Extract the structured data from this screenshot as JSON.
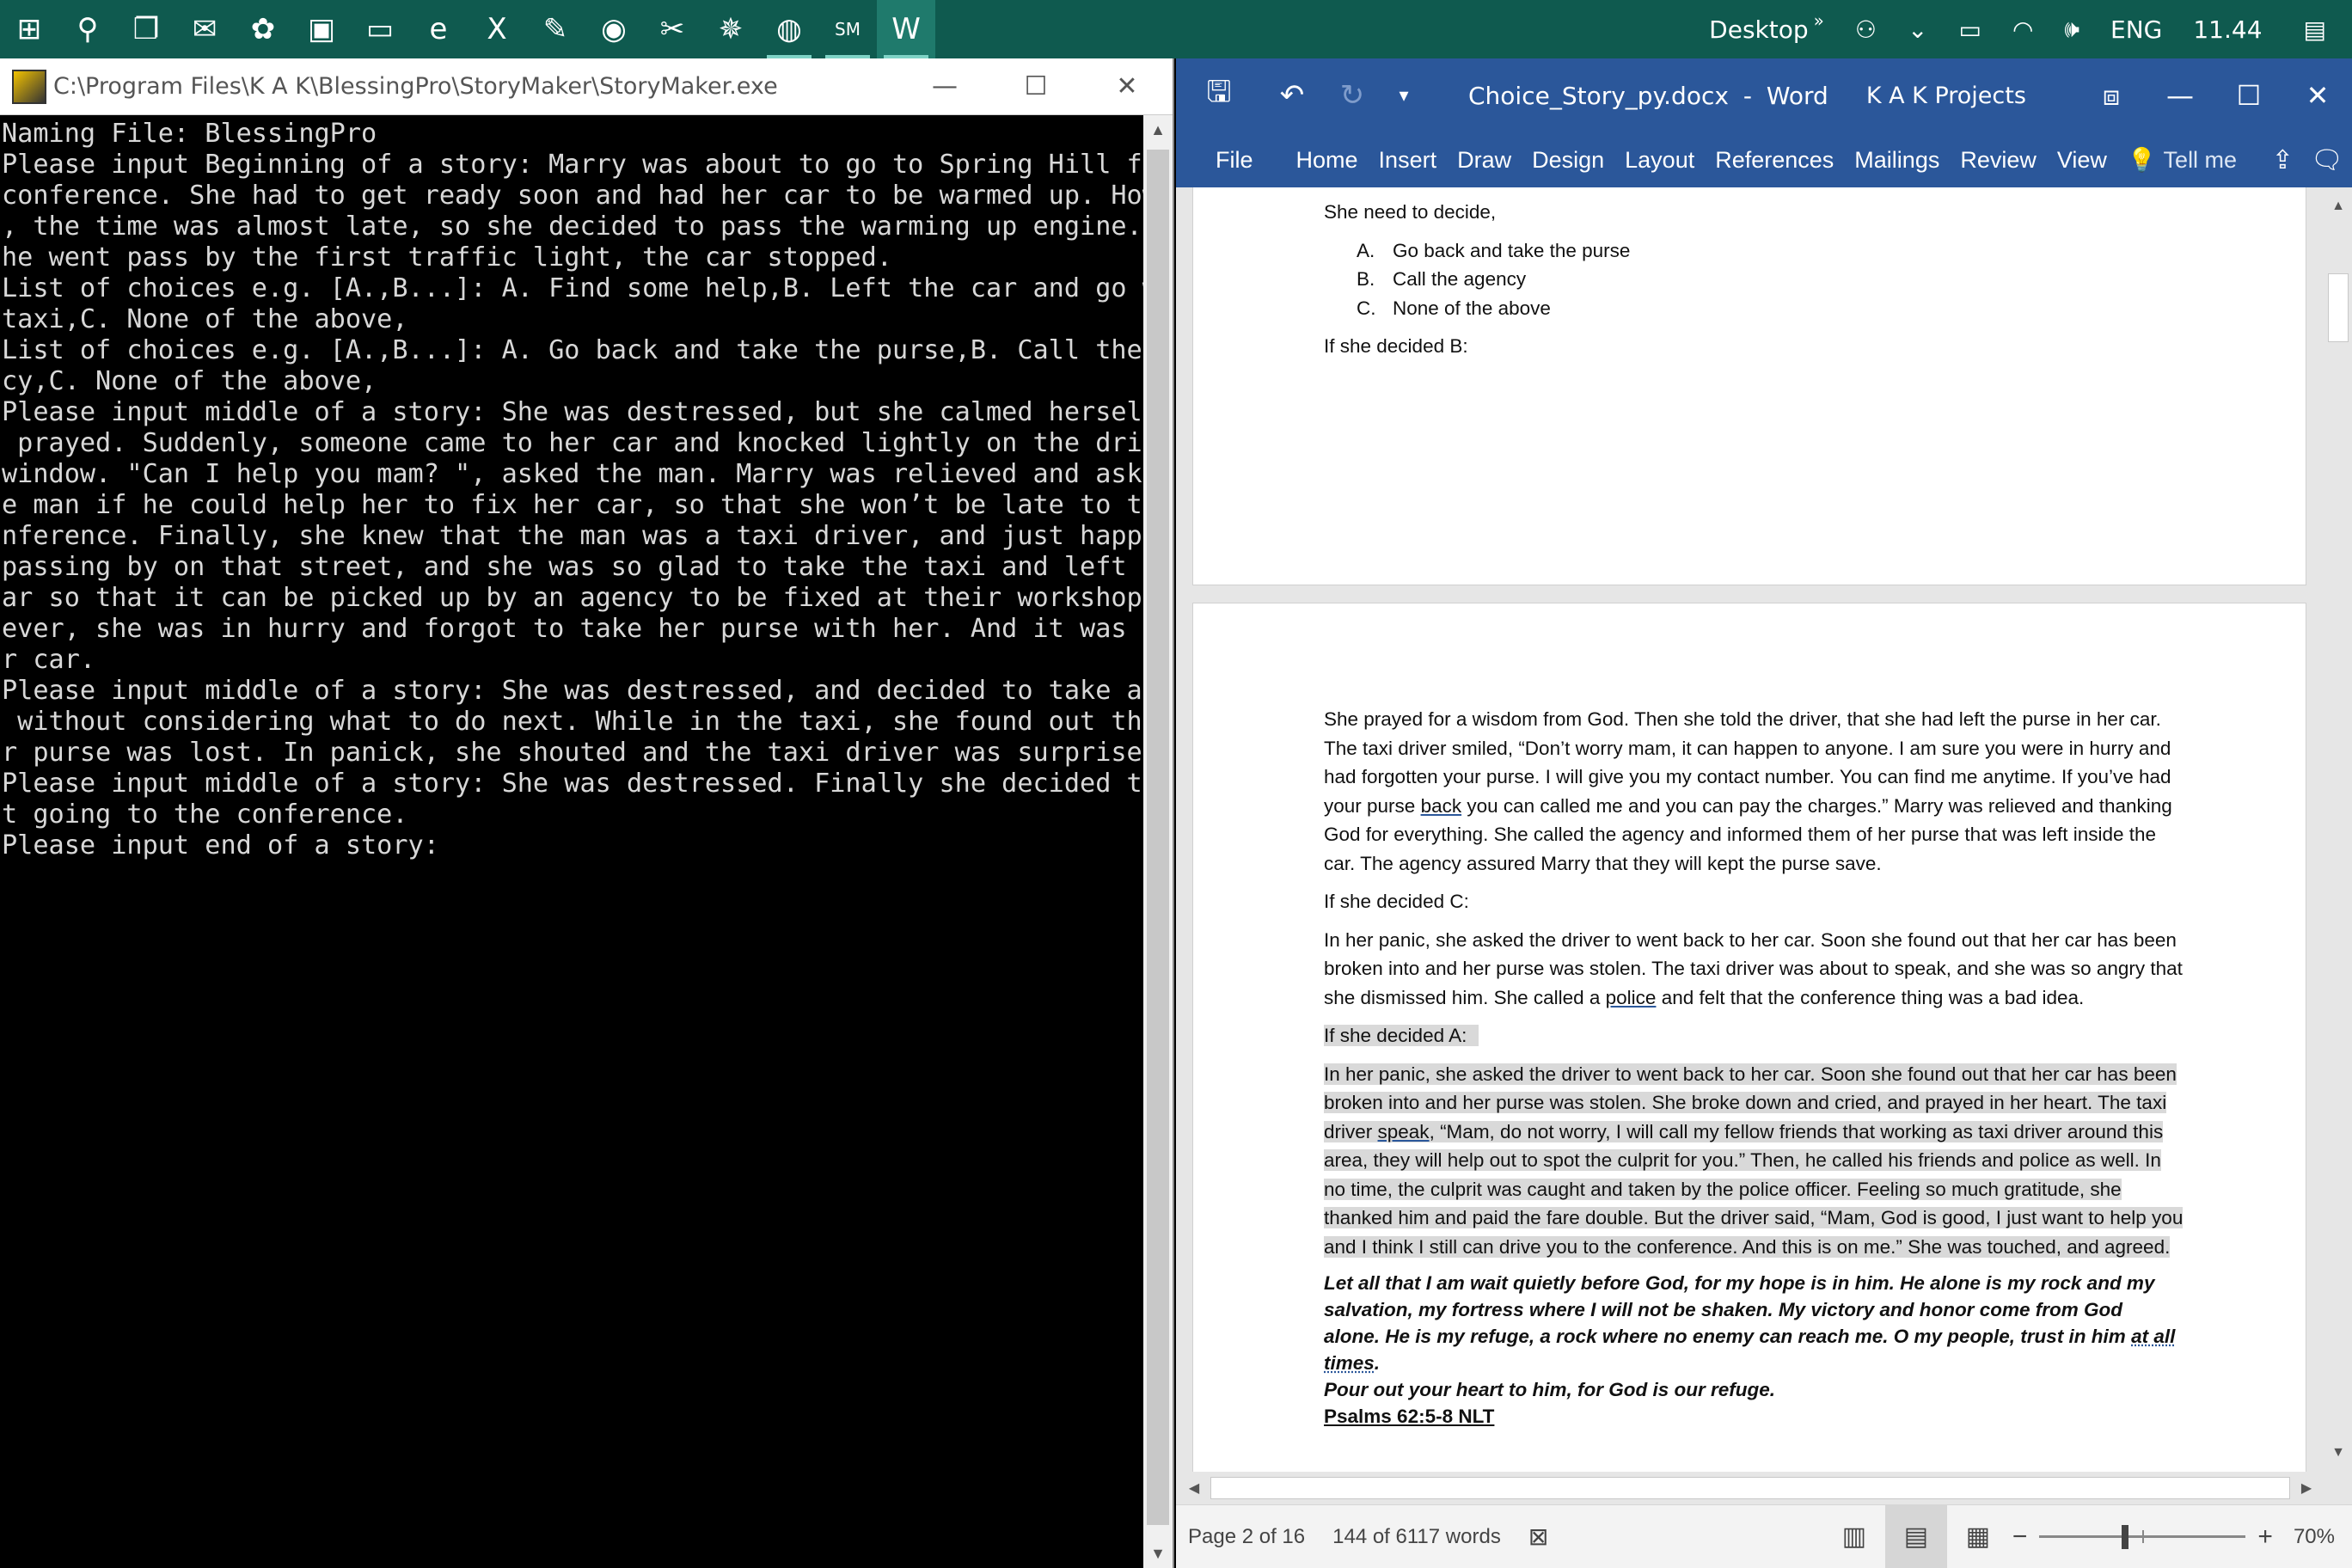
{
  "taskbar": {
    "icons": [
      {
        "name": "start-icon",
        "glyph": "⊞"
      },
      {
        "name": "search-icon",
        "glyph": "⚲"
      },
      {
        "name": "task-view-icon",
        "glyph": "❐"
      },
      {
        "name": "mail-icon",
        "glyph": "✉"
      },
      {
        "name": "paint-icon",
        "glyph": "✿"
      },
      {
        "name": "store-icon",
        "glyph": "▣"
      },
      {
        "name": "file-explorer-icon",
        "glyph": "▭"
      },
      {
        "name": "edge-icon",
        "glyph": "e"
      },
      {
        "name": "excel-icon",
        "glyph": "X"
      },
      {
        "name": "pen-app-icon",
        "glyph": "✎"
      },
      {
        "name": "photo-app-icon",
        "glyph": "◉"
      },
      {
        "name": "tool-app-icon",
        "glyph": "✂"
      },
      {
        "name": "spider-app-icon",
        "glyph": "✵"
      },
      {
        "name": "chrome-icon",
        "glyph": "◍"
      },
      {
        "name": "storymaker-icon",
        "glyph": "SM"
      },
      {
        "name": "word-icon",
        "glyph": "W"
      }
    ],
    "desktop_label": "Desktop",
    "language": "ENG",
    "time": "11.44"
  },
  "console": {
    "title": "C:\\Program Files\\K A K\\BlessingPro\\StoryMaker\\StoryMaker.exe",
    "lines": [
      "Naming File: BlessingPro",
      "Please input Beginning of a story: Marry was about to go to Spring Hill for a",
      "conference. She had to get ready soon and had her car to be warmed up. However",
      ", the time was almost late, so she decided to pass the warming up engine. As s",
      "he went pass by the first traffic light, the car stopped.",
      "List of choices e.g. [A.,B...]: A. Find some help,B. Left the car and go with",
      "taxi,C. None of the above,",
      "List of choices e.g. [A.,B...]: A. Go back and take the purse,B. Call the Agen",
      "cy,C. None of the above,",
      "Please input middle of a story: She was destressed, but she calmed herself and",
      " prayed. Suddenly, someone came to her car and knocked lightly on the driving",
      "window. \"Can I help you mam? \", asked the man. Marry was relieved and asked th",
      "e man if he could help her to fix her car, so that she won’t be late to the co",
      "nference. Finally, she knew that the man was a taxi driver, and just happened",
      "passing by on that street, and she was so glad to take the taxi and left the c",
      "ar so that it can be picked up by an agency to be fixed at their workshop. How",
      "ever, she was in hurry and forgot to take her purse with her. And it was in he",
      "r car.",
      "Please input middle of a story: She was destressed, and decided to take a taxi",
      " without considering what to do next. While in the taxi, she found out that he",
      "r purse was lost. In panick, she shouted and the taxi driver was surprised.",
      "Please input middle of a story: She was destressed. Finally she decided to qui",
      "t going to the conference.",
      "Please input end of a story:"
    ]
  },
  "word": {
    "doc_name": "Choice_Story_py.docx",
    "separator": "-",
    "app_name": "Word",
    "account": "K A K Projects",
    "tabs": [
      "File",
      "Home",
      "Insert",
      "Draw",
      "Design",
      "Layout",
      "References",
      "Mailings",
      "Review",
      "View"
    ],
    "tell_me": "Tell me",
    "page1": {
      "intro": "She need to decide,",
      "options": [
        {
          "label": "A.",
          "text": "Go back and take the purse"
        },
        {
          "label": "B.",
          "text": "Call the agency"
        },
        {
          "label": "C.",
          "text": "None of the above"
        }
      ],
      "decided_b": "If she decided B:"
    },
    "page2": {
      "para_b_1": "She prayed for a wisdom from God. Then she told the driver, that she had left the purse in her car. The taxi driver smiled, “Don’t worry mam, it can happen to anyone. I am sure you were in hurry and had forgotten your purse. I will give you my contact number. You can find me anytime. If you’ve had your purse ",
      "para_b_link": "back",
      "para_b_2": " you can called me and you can pay the charges.” Marry was relieved and thanking God for everything. She called the agency and informed them of her purse that was left inside the car. The agency assured Marry that they will kept the purse save.",
      "decided_c": "If she decided C:",
      "para_c_1": "In her panic, she asked the driver to went back to her car. Soon she found out that her car has been broken into and her purse was stolen. The taxi driver was about to speak, and she was so angry that she dismissed him. She called a ",
      "para_c_link": "police",
      "para_c_2": " and felt that the conference thing was a bad idea.",
      "decided_a": "If she decided A:",
      "para_a_1": "In her panic, she asked the driver to went back to her car. Soon she found out that her car has been broken into and her purse was stolen. She broke down and cried, and prayed in her heart. The taxi driver ",
      "para_a_link": "speak",
      "para_a_2": ", “Mam, do not worry, I will call my fellow friends that working as taxi driver around this area, they will help out to spot the culprit for you.” Then, he called his friends and police as well. In no time, the culprit was caught and taken by the police officer. Feeling so much gratitude, she thanked him and paid the fare double. But the driver said, “Mam, God is good, I just want to help you and I think I still can drive you to the conference. And this is on me.” She was touched, and agreed.",
      "quote_1": "Let all that I am wait quietly before God, for my hope is in him. He alone is my rock and my salvation, my fortress where I will not be shaken. My victory and honor come from God alone. He is my refuge, a rock where no enemy can reach me. O my people, trust in him ",
      "quote_link": "at all times",
      "quote_2": ".",
      "quote_3": "Pour out your heart to him, for God is our refuge.",
      "reference": "Psalms 62:5-8 NLT"
    },
    "status": {
      "page": "Page 2 of 16",
      "words": "144 of 6117 words",
      "zoom": "70%"
    }
  }
}
